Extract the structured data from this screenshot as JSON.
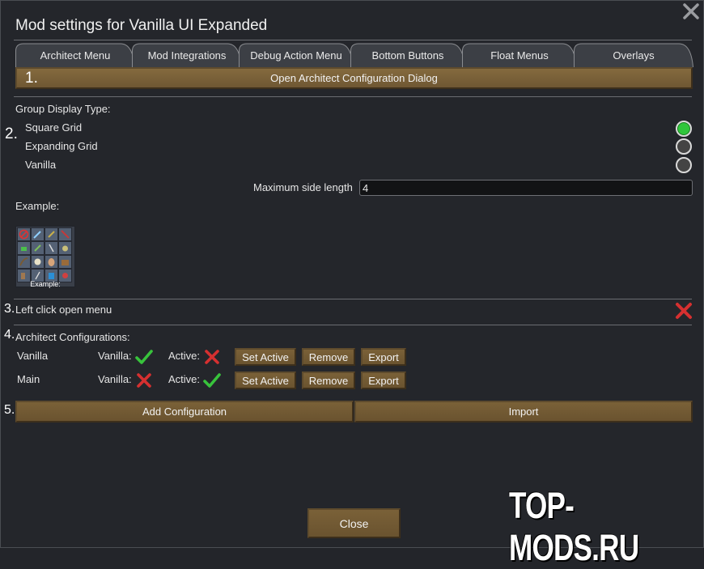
{
  "title": "Mod settings for Vanilla UI Expanded",
  "tabs": [
    "Architect Menu",
    "Mod Integrations",
    "Debug Action Menu",
    "Bottom Buttons",
    "Float Menus",
    "Overlays"
  ],
  "open_dialog_label": "Open Architect Configuration Dialog",
  "markers": [
    "1.",
    "2.",
    "3.",
    "4.",
    "5."
  ],
  "group_display": {
    "heading": "Group Display Type:",
    "options": [
      {
        "label": "Square Grid",
        "selected": true
      },
      {
        "label": "Expanding Grid",
        "selected": false
      },
      {
        "label": "Vanilla",
        "selected": false
      }
    ],
    "max_side_label": "Maximum side length",
    "max_side_value": "4",
    "example_heading": "Example:",
    "example_caption": "Example:"
  },
  "left_click": {
    "label": "Left click open menu",
    "enabled": false
  },
  "configs": {
    "heading": "Architect Configurations:",
    "vanilla_label": "Vanilla:",
    "active_label": "Active:",
    "rows": [
      {
        "name": "Vanilla",
        "vanilla": true,
        "active": false
      },
      {
        "name": "Main",
        "vanilla": false,
        "active": true
      }
    ],
    "set_active": "Set Active",
    "remove": "Remove",
    "export": "Export"
  },
  "add_configuration": "Add Configuration",
  "import": "Import",
  "close": "Close",
  "watermark": "TOP-MODS.RU",
  "colors": {
    "accent_button": "#6f5733",
    "radio_on": "#2fc63b",
    "check": "#38c33c",
    "cross": "#d63030"
  }
}
